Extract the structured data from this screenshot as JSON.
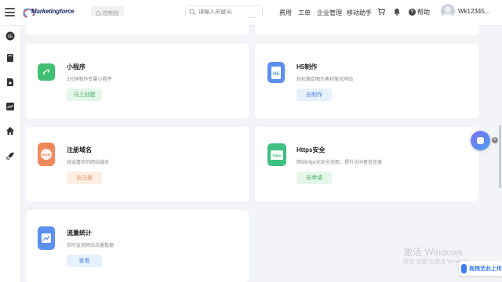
{
  "header": {
    "brand": "Marketingforce",
    "console_label": "控制台",
    "search_placeholder": "请输入关键词",
    "nav": [
      "费用",
      "工单",
      "企业管理",
      "移动助手"
    ],
    "help_label": "帮助",
    "username": "Wk12345..."
  },
  "cards": [
    {
      "title": "小程序",
      "desc": "3分钟制作专属小程序",
      "button": "马上创建",
      "icon": "mini-program-icon",
      "color": "#41bf73"
    },
    {
      "title": "H5制作",
      "desc": "轻松搞定图片素材美化网站",
      "button": "去制作",
      "icon": "h5-icon",
      "color": "#5b8ff0"
    },
    {
      "title": "注册域名",
      "desc": "挑选喜欢的网站域名",
      "button": "去注册",
      "icon": "www-icon",
      "color": "#f0895a"
    },
    {
      "title": "Https安全",
      "desc": "网站https化安全加密，提升访问者信任度",
      "button": "去申请",
      "icon": "https-icon",
      "color": "#3ec080"
    },
    {
      "title": "流量统计",
      "desc": "实时监测网站流量数据",
      "button": "查看",
      "icon": "traffic-chart-icon",
      "color": "#5b8ff0"
    }
  ],
  "watermark": {
    "line1": "激活 Windows",
    "line2": "转到\"设置\"以激活 Windows。"
  },
  "pin_label": "拖拽至此上传"
}
